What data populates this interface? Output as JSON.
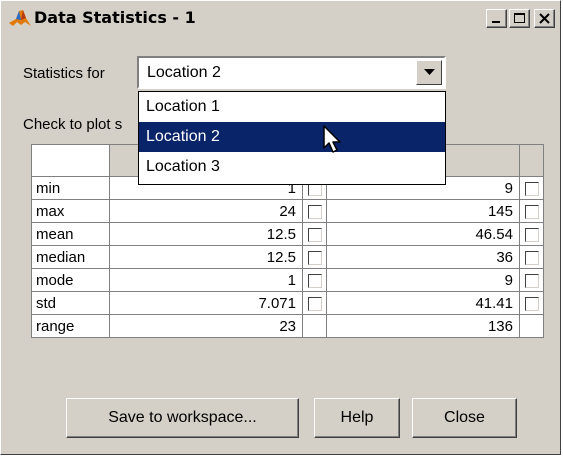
{
  "window": {
    "title": "Data Statistics - 1",
    "icon": "matlab-icon",
    "controls": [
      "minimize-icon",
      "maximize-icon",
      "close-icon"
    ]
  },
  "statistics_label": "Statistics for",
  "select": {
    "value": "Location 2"
  },
  "check_label": "Check to plot s",
  "dropdown": {
    "options": [
      "Location 1",
      "Location 2",
      "Location 3"
    ],
    "highlighted": "Location 2"
  },
  "table": {
    "rows": [
      {
        "name": "min",
        "v1": "1",
        "v2": "9",
        "checkboxes": true
      },
      {
        "name": "max",
        "v1": "24",
        "v2": "145",
        "checkboxes": true
      },
      {
        "name": "mean",
        "v1": "12.5",
        "v2": "46.54",
        "checkboxes": true
      },
      {
        "name": "median",
        "v1": "12.5",
        "v2": "36",
        "checkboxes": true
      },
      {
        "name": "mode",
        "v1": "1",
        "v2": "9",
        "checkboxes": true
      },
      {
        "name": "std",
        "v1": "7.071",
        "v2": "41.41",
        "checkboxes": true
      },
      {
        "name": "range",
        "v1": "23",
        "v2": "136",
        "checkboxes": false
      }
    ]
  },
  "buttons": {
    "save": "Save to workspace...",
    "help": "Help",
    "close": "Close"
  },
  "colors": {
    "face": "#d4d0c8",
    "selection": "#0a246a"
  }
}
